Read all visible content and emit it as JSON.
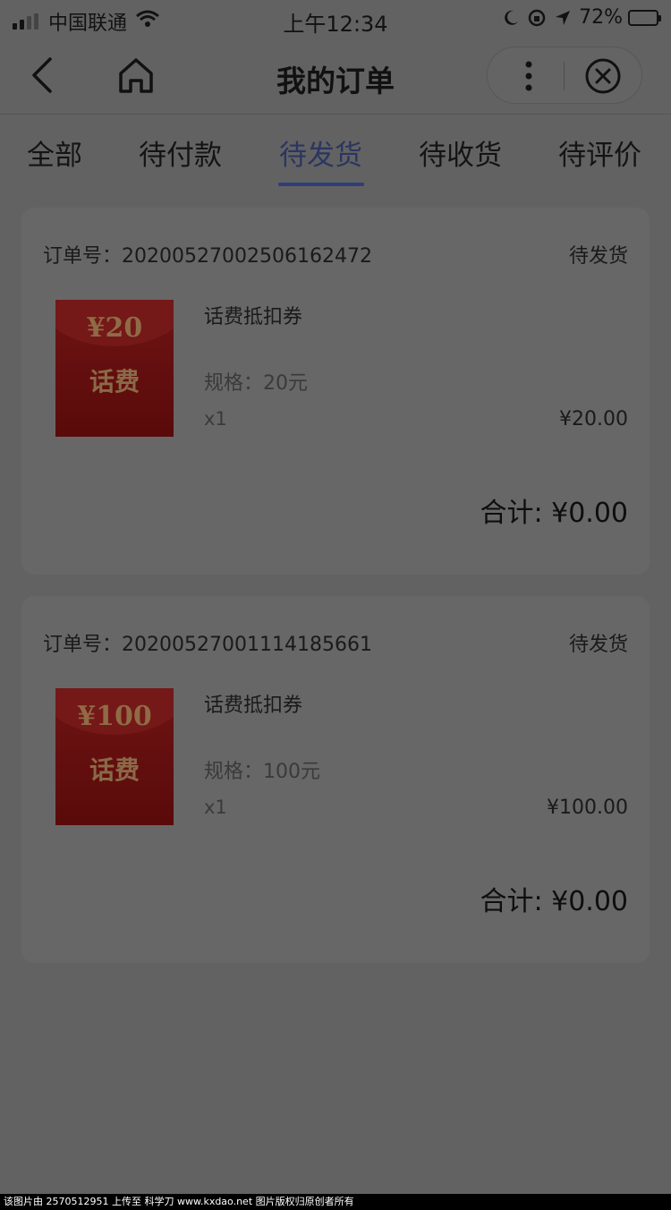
{
  "status_bar": {
    "carrier": "中国联通",
    "time": "上午12:34",
    "battery": "72%"
  },
  "nav": {
    "title": "我的订单"
  },
  "tabs": [
    {
      "label": "全部",
      "active": false
    },
    {
      "label": "待付款",
      "active": false
    },
    {
      "label": "待发货",
      "active": true
    },
    {
      "label": "待收货",
      "active": false
    },
    {
      "label": "待评价",
      "active": false
    }
  ],
  "orders": [
    {
      "order_no_label": "订单号：",
      "order_no": "20200527002506162472",
      "status": "待发货",
      "coupon_amount": "¥20",
      "coupon_label": "话费",
      "product_name": "话费抵扣券",
      "spec": "规格：20元",
      "qty": "x1",
      "price": "¥20.00",
      "total": "合计: ¥0.00"
    },
    {
      "order_no_label": "订单号：",
      "order_no": "20200527001114185661",
      "status": "待发货",
      "coupon_amount": "¥100",
      "coupon_label": "话费",
      "product_name": "话费抵扣券",
      "spec": "规格：100元",
      "qty": "x1",
      "price": "¥100.00",
      "total": "合计: ¥0.00"
    }
  ],
  "watermark": "该图片由 2570512951 上传至 科学刀 www.kxdao.net 图片版权归原创者所有",
  "colors": {
    "overlay_bg": "#626262",
    "active_tab": "#2f3d78",
    "coupon_red": "#6e1414"
  }
}
